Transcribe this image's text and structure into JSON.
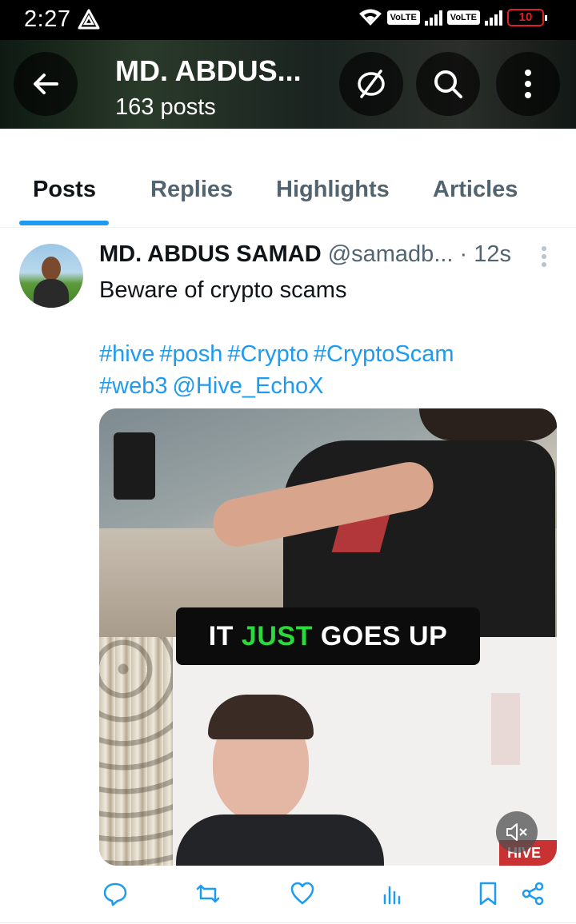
{
  "status_bar": {
    "time": "2:27",
    "volte_1": "VoLTE",
    "volte_2": "VoLTE",
    "battery": "10"
  },
  "header": {
    "title": "MD. ABDUS...",
    "posts_count": "163 posts"
  },
  "tabs": [
    {
      "label": "Posts",
      "active": true
    },
    {
      "label": "Replies",
      "active": false
    },
    {
      "label": "Highlights",
      "active": false
    },
    {
      "label": "Articles",
      "active": false
    }
  ],
  "post": {
    "author": "MD. ABDUS SAMAD",
    "handle": "@samadb...",
    "separator": "·",
    "time": "12s",
    "text": "Beware of crypto scams",
    "tags": [
      "#hive",
      "#posh",
      "#Crypto",
      "#CryptoScam",
      "#web3",
      "@Hive_EchoX"
    ],
    "media": {
      "caption_before": "IT",
      "caption_highlight": "JUST",
      "caption_after": "GOES UP",
      "caption_highlight_color": "#2ad93a",
      "watermark": "HIVE"
    }
  },
  "colors": {
    "accent": "#1d9bf0",
    "text": "#0f1419",
    "muted": "#536471"
  },
  "icons": [
    "back-arrow-icon",
    "no-sync-icon",
    "search-icon",
    "more-vertical-icon",
    "reply-icon",
    "repost-icon",
    "like-icon",
    "views-icon",
    "bookmark-icon",
    "share-icon",
    "mute-icon"
  ]
}
